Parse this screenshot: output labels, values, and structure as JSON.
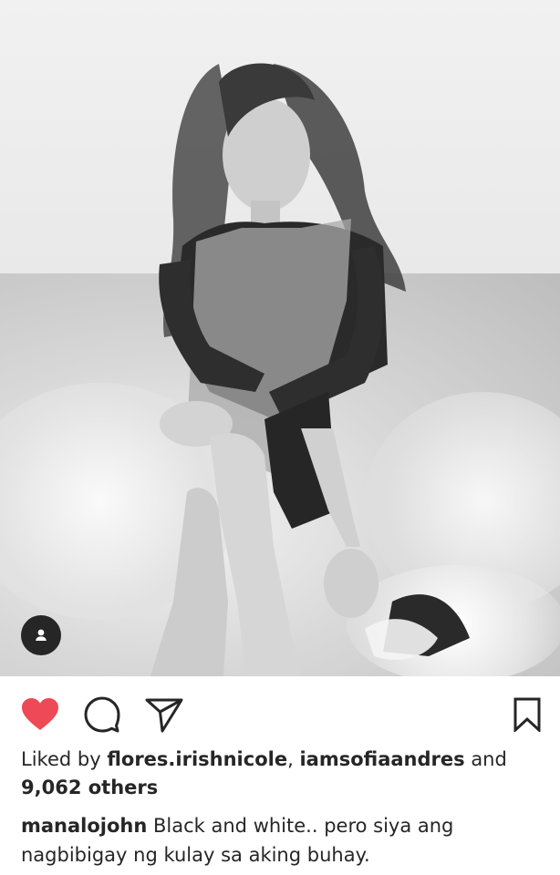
{
  "post": {
    "likes": {
      "prefix": "Liked by",
      "user1": "flores.irishnicole",
      "separator": ",",
      "user2": "iamsofiaandres",
      "conjunction": "and",
      "count_text": "9,062 others"
    },
    "caption": {
      "username": "manalojohn",
      "text": "Black and white.. pero siya ang nagbibigay ng kulay sa aking buhay."
    }
  },
  "icons": {
    "like": "heart-icon",
    "comment": "comment-icon",
    "share": "paper-plane-icon",
    "save": "bookmark-icon",
    "tag": "user-tag-icon"
  },
  "colors": {
    "liked": "#ed4956",
    "icon": "#262626",
    "text": "#262626"
  }
}
